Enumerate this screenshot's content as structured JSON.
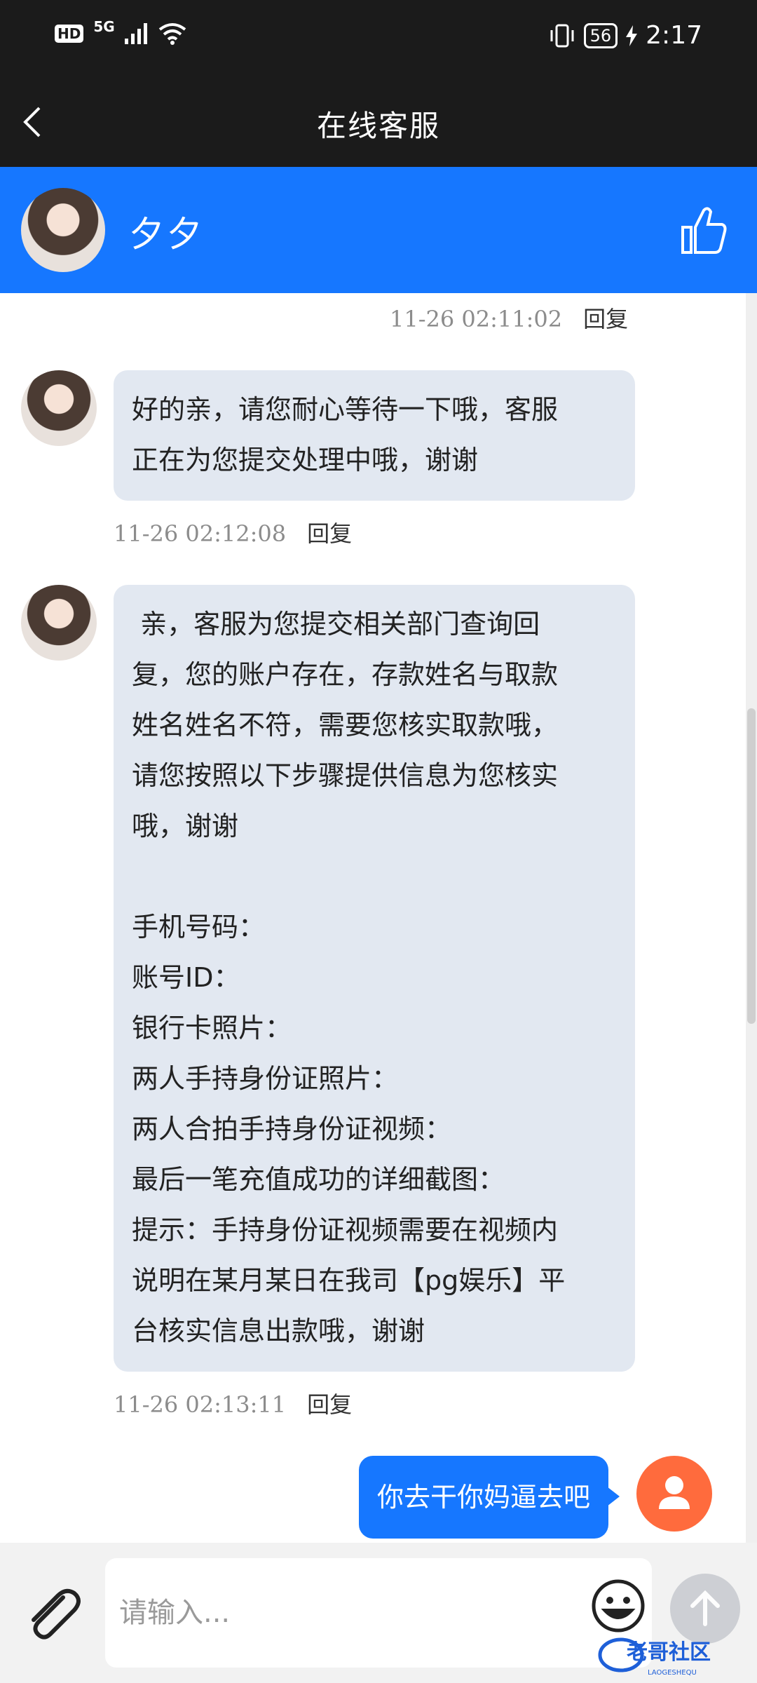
{
  "status_bar": {
    "hd": "HD",
    "network": "5G",
    "battery": "56",
    "time": "2:17"
  },
  "title_bar": {
    "title": "在线客服"
  },
  "agent": {
    "name": "夕夕"
  },
  "messages": [
    {
      "time": "11-26 02:11:02",
      "reply_label": "回复"
    },
    {
      "from": "agent",
      "text": "好的亲，请您耐心等待一下哦，客服\n正在为您提交处理中哦，谢谢",
      "time": "11-26 02:12:08",
      "reply_label": "回复"
    },
    {
      "from": "agent",
      "text": " 亲，客服为您提交相关部门查询回\n复，您的账户存在，存款姓名与取款\n姓名姓名不符，需要您核实取款哦，\n请您按照以下步骤提供信息为您核实\n哦，谢谢\n\n手机号码：\n账号ID：\n银行卡照片：\n两人手持身份证照片：\n两人合拍手持身份证视频：\n最后一笔充值成功的详细截图：\n提示：手持身份证视频需要在视频内\n说明在某月某日在我司【pg娱乐】平\n台核实信息出款哦，谢谢",
      "time": "11-26 02:13:11",
      "reply_label": "回复"
    },
    {
      "from": "user",
      "text": "你去干你妈逼去吧"
    }
  ],
  "composer": {
    "placeholder": "请输入..."
  },
  "watermark": {
    "text": "老哥社区",
    "subtext": "LAOGESHEQU"
  },
  "colors": {
    "primary": "#1677ff",
    "user_avatar": "#ff6b3d",
    "bubble_in": "#e2e8f1",
    "status_bar": "#1b1b1b"
  }
}
